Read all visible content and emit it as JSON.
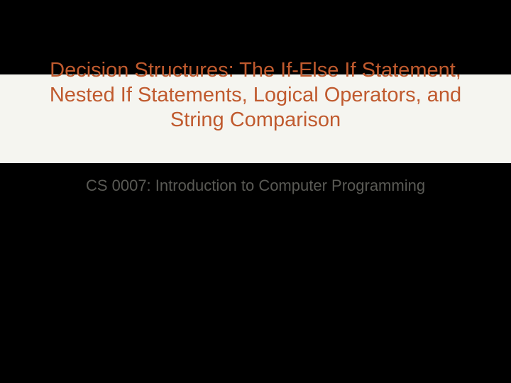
{
  "slide": {
    "title": "Decision Structures: The If-Else If Statement, Nested If Statements, Logical Operators, and String Comparison",
    "subtitle": "CS 0007:  Introduction to Computer Programming"
  },
  "colors": {
    "background": "#000000",
    "band": "#f5f5f0",
    "title_text": "#c05a2e",
    "subtitle_text": "#5a5a55"
  }
}
